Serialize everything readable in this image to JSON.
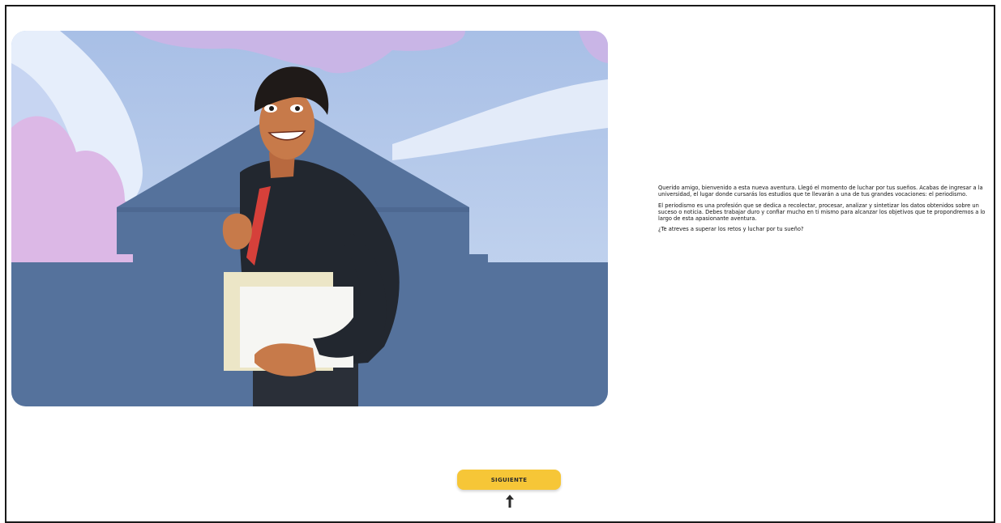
{
  "intro": {
    "paragraph_1": "Querido amigo, bienvenido a esta nueva aventura. Llegó el momento de luchar por tus sueños. Acabas de ingresar a la universidad, el lugar donde cursarás los estudios que te llevarán a una de tus grandes vocaciones: el periodismo.",
    "paragraph_2": "El periodismo es una profesión que se dedica a recolectar, procesar, analizar y sintetizar los datos obtenidos sobre un suceso o noticia. Debes trabajar duro y confiar mucho en ti mismo para alcanzar los objetivos que te propondremos a lo largo de esta apasionante aventura.",
    "paragraph_3": "¿Te atreves a superar los retos y luchar por tu sueño?"
  },
  "buttons": {
    "next_label": "SIGUIENTE"
  },
  "icons": {
    "cursor": "mouse-pointer-icon"
  },
  "colors": {
    "button_bg": "#f6c637",
    "sky": "#b7c9ea",
    "building": "#55729c",
    "cloud_pink": "#dcb8e6"
  }
}
